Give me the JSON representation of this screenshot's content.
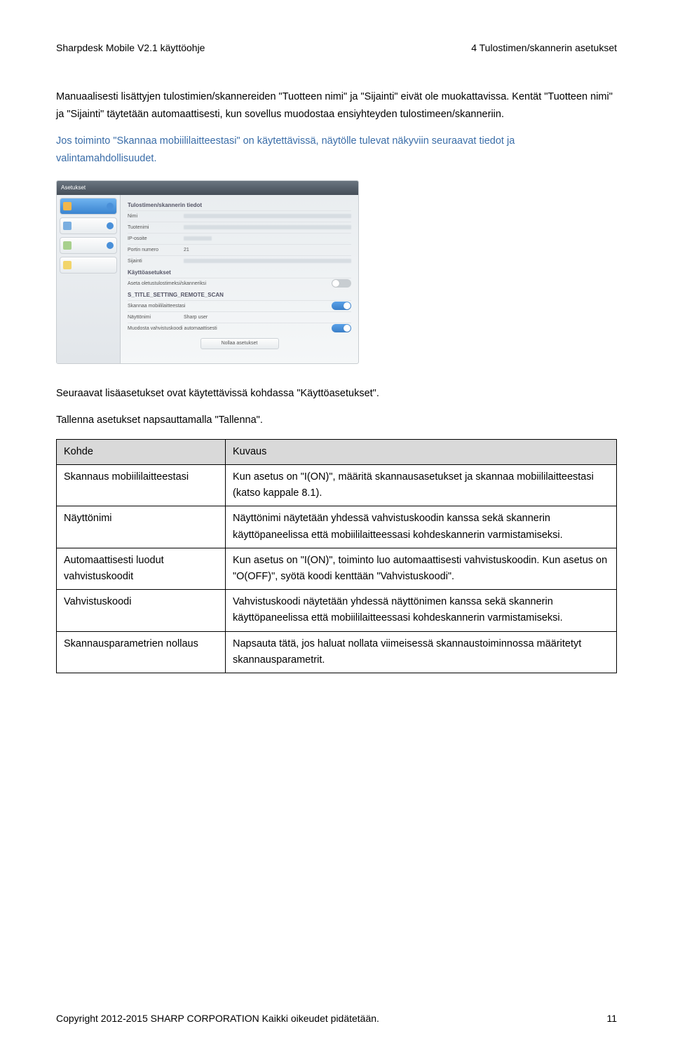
{
  "header": {
    "left": "Sharpdesk Mobile V2.1 käyttöohje",
    "right": "4 Tulostimen/skannerin asetukset"
  },
  "para1": "Manuaalisesti lisättyjen tulostimien/skannereiden \"Tuotteen nimi\" ja \"Sijainti\" eivät ole muokattavissa. Kentät \"Tuotteen nimi\" ja \"Sijainti\" täytetään automaattisesti, kun sovellus muodostaa ensiyhteyden tulostimeen/skanneriin.",
  "para2": "Jos toiminto \"Skannaa mobiililaitteestasi\" on käytettävissä, näytölle tulevat näkyviin seuraavat tiedot ja valintamahdollisuudet.",
  "shot": {
    "title": "Asetukset",
    "sect1": "Tulostimen/skannerin tiedot",
    "r_nimi": "Nimi",
    "r_tuotenimi": "Tuotenimi",
    "r_ip": "IP-osoite",
    "r_port": "Portin numero",
    "r_port_val": "21",
    "r_sijainti": "Sijainti",
    "sect2": "Käyttöasetukset",
    "r_aseta": "Aseta oletustulostimeksi/skanneriksi",
    "sect3": "S_TITLE_SETTING_REMOTE_SCAN",
    "r_skannaa": "Skannaa mobiililaitteestasi",
    "r_naytto": "Näyttönimi",
    "r_naytto_val": "Sharp user",
    "r_muodosta": "Muodosta vahvistuskoodi automaattisesti",
    "btn": "Nollaa asetukset"
  },
  "para3": "Seuraavat lisäasetukset ovat käytettävissä kohdassa \"Käyttöasetukset\".",
  "para4": "Tallenna asetukset napsauttamalla \"Tallenna\".",
  "table": {
    "h1": "Kohde",
    "h2": "Kuvaus",
    "r1c1": "Skannaus mobiililaitteestasi",
    "r1c2": "Kun asetus on \"I(ON)\", määritä skannausasetukset ja skannaa mobiililaitteestasi (katso kappale 8.1).",
    "r2c1": "Näyttönimi",
    "r2c2": "Näyttönimi näytetään yhdessä vahvistuskoodin kanssa sekä skannerin käyttöpaneelissa että mobiililaitteessasi kohdeskannerin varmistamiseksi.",
    "r3c1": "Automaattisesti luodut vahvistuskoodit",
    "r3c2": "Kun asetus on \"I(ON)\", toiminto luo automaattisesti vahvistuskoodin. Kun asetus on \"O(OFF)\", syötä koodi kenttään \"Vahvistuskoodi\".",
    "r4c1": "Vahvistuskoodi",
    "r4c2": "Vahvistuskoodi näytetään yhdessä näyttönimen kanssa sekä skannerin käyttöpaneelissa että mobiililaitteessasi kohdeskannerin varmistamiseksi.",
    "r5c1": "Skannausparametrien nollaus",
    "r5c2": "Napsauta tätä, jos haluat nollata viimeisessä skannaustoiminnossa määritetyt skannausparametrit."
  },
  "footer": {
    "left": "Copyright 2012-2015 SHARP CORPORATION Kaikki oikeudet pidätetään.",
    "right": "11"
  }
}
